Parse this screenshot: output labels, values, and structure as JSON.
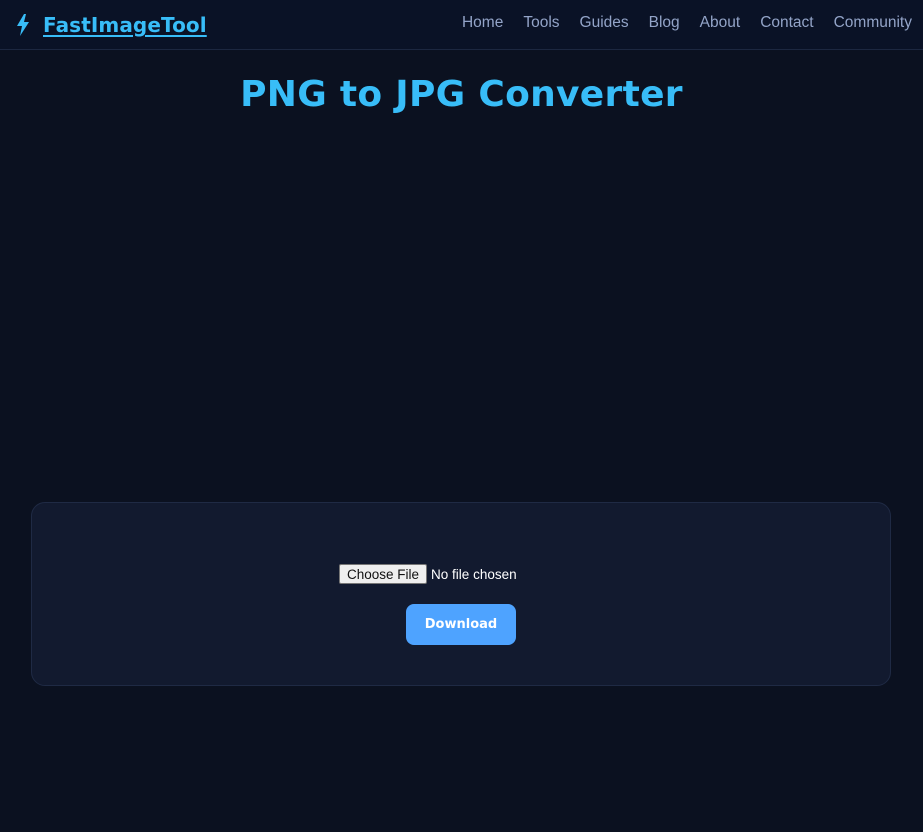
{
  "header": {
    "brand": {
      "name": "FastImageTool",
      "icon": "lightning-bolt-icon",
      "color": "#38bdf8"
    },
    "nav": [
      {
        "label": "Home"
      },
      {
        "label": "Tools"
      },
      {
        "label": "Guides"
      },
      {
        "label": "Blog"
      },
      {
        "label": "About"
      },
      {
        "label": "Contact"
      },
      {
        "label": "Community"
      }
    ]
  },
  "main": {
    "title": "PNG to JPG Converter",
    "converter": {
      "file_button_label": "Choose File",
      "file_status": "No file chosen",
      "download_label": "Download",
      "accent_color": "#4ea3ff"
    }
  },
  "colors": {
    "background": "#0b1120",
    "panel": "#121a2f",
    "nav_text": "#93a4c8"
  }
}
